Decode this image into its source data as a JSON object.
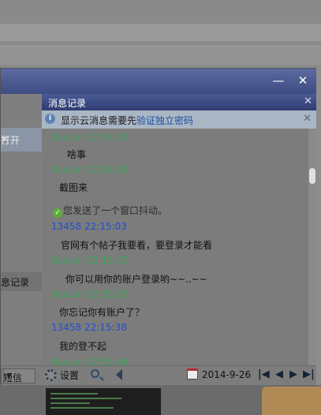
{
  "window": {
    "title_buttons": {
      "minimize": "—",
      "close": "✕"
    }
  },
  "left_panel": {
    "notice_text": "打开",
    "close_glyph": "✕",
    "history_label": "息记录"
  },
  "panel": {
    "title": "消息记录",
    "close_glyph": "✕",
    "notice": {
      "info_glyph": "i",
      "text_before": "显示云消息需要先",
      "link_text": "验证独立密码",
      "close_glyph": "✕"
    }
  },
  "messages": [
    {
      "kind": "meta",
      "color": "green",
      "sender": "SiuLun",
      "time": "22:14:25"
    },
    {
      "kind": "text",
      "text": "啥事"
    },
    {
      "kind": "meta",
      "color": "green",
      "sender": "SiuLun",
      "time": "22:14:26"
    },
    {
      "kind": "text",
      "text": "截图来"
    },
    {
      "kind": "system",
      "text": "您发送了一个窗口抖动。"
    },
    {
      "kind": "meta",
      "color": "blue",
      "sender": "13458",
      "time": "22:15:03"
    },
    {
      "kind": "text",
      "text": "官网有个帖子我要看，要登录才能看"
    },
    {
      "kind": "meta",
      "color": "green",
      "sender": "SiuLun",
      "time": "22:15:20"
    },
    {
      "kind": "text",
      "text": "你可以用你的账户登录哟~~..~~"
    },
    {
      "kind": "meta",
      "color": "green",
      "sender": "SiuLun",
      "time": "22:15:26"
    },
    {
      "kind": "text",
      "text": "你忘记你有账户了？"
    },
    {
      "kind": "meta",
      "color": "blue",
      "sender": "13458",
      "time": "22:15:38"
    },
    {
      "kind": "text",
      "text": "我的登不起"
    },
    {
      "kind": "meta",
      "color": "green",
      "sender": "SiuLun",
      "time": "22:15:44"
    }
  ],
  "toolbar": {
    "select_value": "短信",
    "settings_label": "设置",
    "date": "2014-9-26",
    "nav": {
      "first": "|◀",
      "prev": "◀",
      "next": "▶",
      "last": "▶|"
    }
  },
  "icons": [
    "info-icon",
    "check-icon",
    "gear-icon",
    "search-icon",
    "speaker-icon",
    "calendar-icon"
  ],
  "colors": {
    "meta_green": "#3fa05a",
    "meta_blue": "#1f4fd0",
    "link": "#1d4fa3",
    "title_bar": "#3e4c83"
  }
}
